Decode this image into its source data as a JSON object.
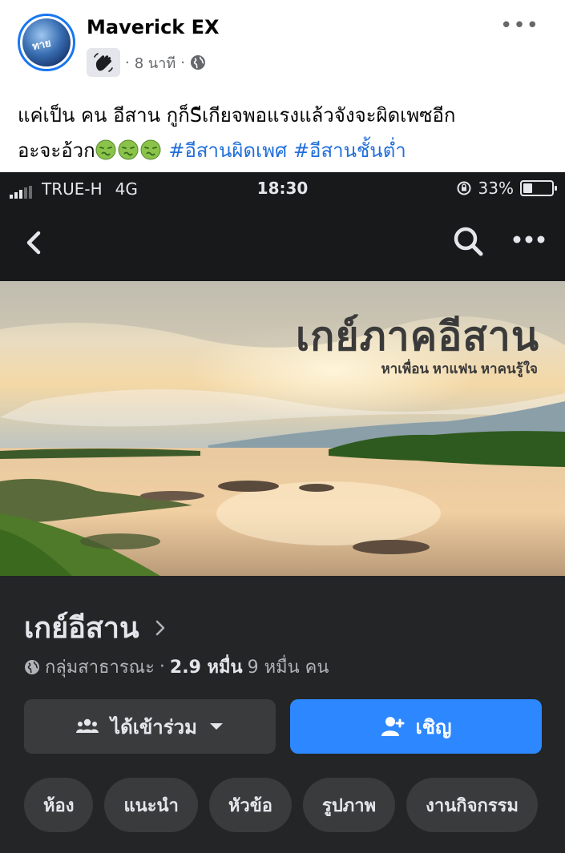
{
  "post": {
    "author": "Maverick EX",
    "time": "8 นาที",
    "separator": "·",
    "body_line1": "แค่เป็น คน อีสาน กูก็Sีเกียจพอแรงแล้วจังจะผิดเพซอีก",
    "body_line2_prefix": "อะจะอ้วก",
    "hashtag1": "#อีสานผิดเพศ",
    "hashtag2": "#อีสานชั้นต่ำ",
    "emoji": "nauseated-face-emoji",
    "avatar_text": "ทาย",
    "more_icon": "more-horizontal-icon"
  },
  "screenshot": {
    "status": {
      "carrier": "TRUE-H",
      "network": "4G",
      "time": "18:30",
      "battery": "33%",
      "battery_level": 0.33
    },
    "cover": {
      "title": "เกย์ภาคอีสาน",
      "subtitle": "หาเพื่อน หาแฟน หาคนรู้ใจ"
    },
    "group": {
      "name": "เกย์อีสาน",
      "privacy": "กลุ่มสาธารณะ",
      "dot": "·",
      "members_bold": "2.9 หมื่น",
      "members_rest": "9 หมื่น คน"
    },
    "buttons": {
      "joined": "ได้เข้าร่วม",
      "invite": "เชิญ"
    },
    "tabs": [
      "ห้อง",
      "แนะนำ",
      "หัวข้อ",
      "รูปภาพ",
      "งานกิจกรรม"
    ]
  },
  "colors": {
    "accent": "#2d88ff",
    "hashtag": "#216fdb",
    "dark_bg": "#242526",
    "dark_button": "#3a3b3c"
  }
}
